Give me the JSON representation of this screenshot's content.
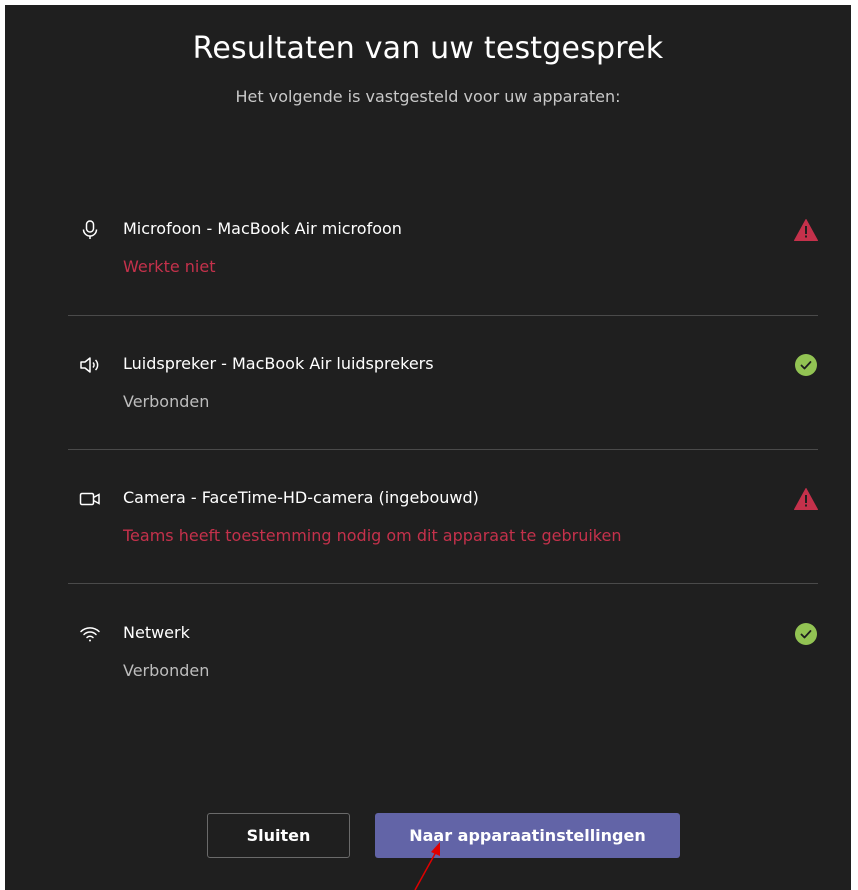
{
  "dialog": {
    "title": "Resultaten van uw testgesprek",
    "subtitle": "Het volgende is vastgesteld voor uw apparaten:"
  },
  "devices": [
    {
      "icon": "microphone-icon",
      "name": "Microfoon - MacBook Air microfoon",
      "status": "Werkte niet",
      "state": "error",
      "badge_icon": "warning-icon"
    },
    {
      "icon": "speaker-icon",
      "name": "Luidspreker - MacBook Air luidsprekers",
      "status": "Verbonden",
      "state": "ok",
      "badge_icon": "check-icon"
    },
    {
      "icon": "camera-icon",
      "name": "Camera - FaceTime-HD-camera (ingebouwd)",
      "status": "Teams heeft toestemming nodig om dit apparaat te gebruiken",
      "state": "error",
      "badge_icon": "warning-icon"
    },
    {
      "icon": "wifi-icon",
      "name": "Netwerk",
      "status": "Verbonden",
      "state": "ok",
      "badge_icon": "check-icon"
    }
  ],
  "buttons": {
    "close_label": "Sluiten",
    "settings_label": "Naar apparaatinstellingen"
  },
  "colors": {
    "background": "#1f1f1f",
    "error": "#c4314b",
    "success": "#92c353",
    "primary": "#6264a7",
    "annotation_arrow": "#e00000"
  }
}
